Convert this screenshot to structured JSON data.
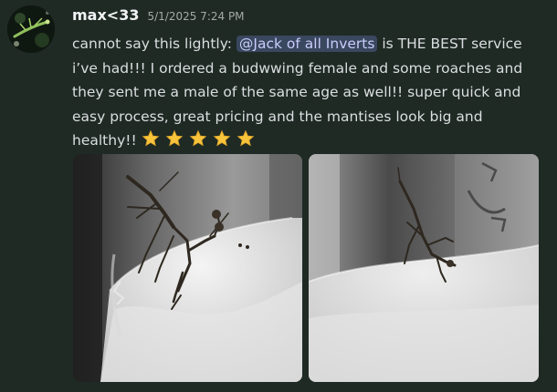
{
  "message": {
    "author": "max<33",
    "timestamp": "5/1/2025 7:24 PM",
    "text_before": "cannot say this lightly: ",
    "mention": "@Jack of all Inverts",
    "text_after": " is THE BEST service i’ve had!!! I ordered a budwwing female and some roaches and they sent me a male of the same age as well!! super quick and easy process, great pricing and the mantises look big and healthy!!",
    "reactions_inline": [
      "star-emoji",
      "star-emoji",
      "star-emoji",
      "star-emoji",
      "star-emoji"
    ]
  },
  "attachments": [
    {
      "icon": "photo-mantis-1"
    },
    {
      "icon": "photo-mantis-2"
    }
  ],
  "colors": {
    "background": "#1f2a24",
    "username": "#f2f3f5",
    "timestamp": "#a5aaa7",
    "text": "#dbdee1",
    "mention_bg": "#39475f",
    "mention_text": "#c9cdfb",
    "star": "#f7c43b"
  }
}
